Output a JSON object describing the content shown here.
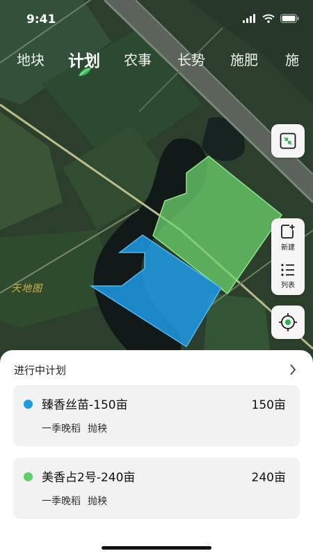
{
  "status": {
    "time": "9:41"
  },
  "tabs": [
    "地块",
    "计划",
    "农事",
    "长势",
    "施肥",
    "施"
  ],
  "active_tab": "计划",
  "map": {
    "watermark": "天地图",
    "field_colors": {
      "blue": "#1e9be6",
      "green": "#6cd36c"
    },
    "buttons": {
      "new_label": "新建",
      "list_label": "列表"
    }
  },
  "sheet": {
    "title": "进行中计划",
    "plans": [
      {
        "name": "臻香丝苗-150亩",
        "area": "150亩",
        "season": "一季晚稻",
        "method": "抛秧",
        "color": "#1e9be6"
      },
      {
        "name": "美香占2号-240亩",
        "area": "240亩",
        "season": "一季晚稻",
        "method": "抛秧",
        "color": "#5fd06a"
      }
    ]
  }
}
